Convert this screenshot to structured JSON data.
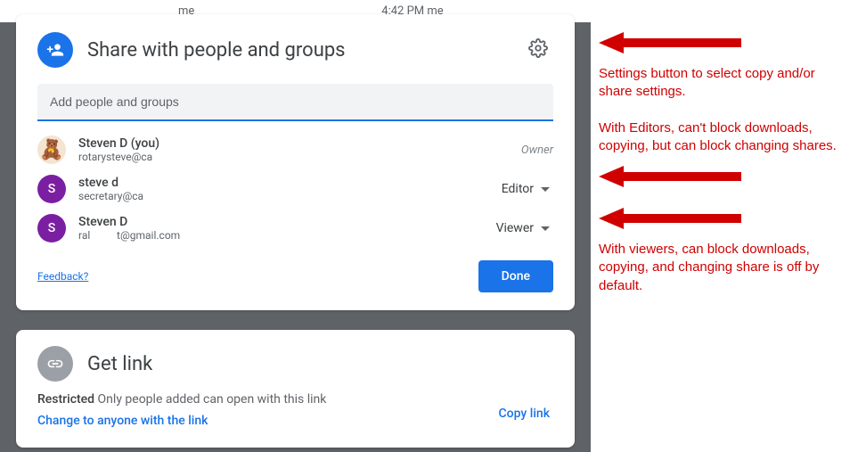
{
  "background": {
    "sender": "me",
    "time": "4:42 PM",
    "recipient": "me"
  },
  "share": {
    "title": "Share with people and groups",
    "input_placeholder": "Add people and groups",
    "people": [
      {
        "name": "Steven D (you)",
        "email": "rotarysteve@ca",
        "role": "Owner",
        "avatar_type": "image",
        "avatar_letter": "🧸"
      },
      {
        "name": "steve d",
        "email": "secretary@ca",
        "role": "Editor",
        "avatar_type": "letter",
        "avatar_letter": "S"
      },
      {
        "name": "Steven D",
        "email": "ral          t@gmail.com",
        "role": "Viewer",
        "avatar_type": "letter",
        "avatar_letter": "S"
      }
    ],
    "feedback": "Feedback?",
    "done": "Done"
  },
  "link": {
    "title": "Get link",
    "restricted_label": "Restricted",
    "restricted_desc": "Only people added can open with this link",
    "change": "Change to anyone with the link",
    "copy": "Copy link"
  },
  "annotations": [
    "Settings button to select copy and/or share settings.",
    "With Editors, can't block downloads, copying, but can block changing shares.",
    "With viewers, can block downloads, copying, and changing share is off by default."
  ]
}
